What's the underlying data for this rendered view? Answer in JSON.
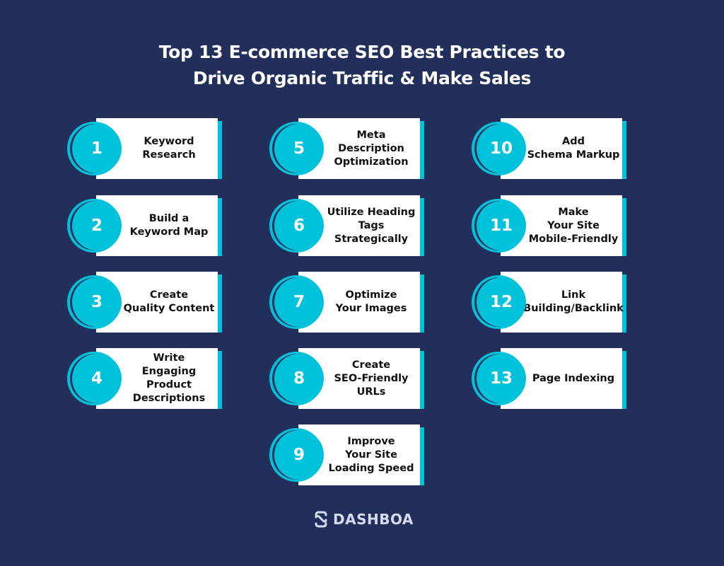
{
  "title": {
    "line1": "Top 13 E-commerce SEO Best Practices to",
    "line2": "Drive Organic Traffic & Make Sales"
  },
  "items": [
    {
      "number": "1",
      "label": "Keyword\nResearch"
    },
    {
      "number": "2",
      "label": "Build a\nKeyword Map"
    },
    {
      "number": "3",
      "label": "Create\nQuality Content"
    },
    {
      "number": "4",
      "label": "Write\nEngaging Product\nDescriptions"
    },
    {
      "number": "5",
      "label": "Meta Description\nOptimization"
    },
    {
      "number": "6",
      "label": "Utilize Heading\nTags Strategically"
    },
    {
      "number": "7",
      "label": "Optimize\nYour Images"
    },
    {
      "number": "8",
      "label": "Create\nSEO-Friendly URLs"
    },
    {
      "number": "9",
      "label": "Improve\nYour Site\nLoading Speed"
    },
    {
      "number": "10",
      "label": "Add\nSchema Markup"
    },
    {
      "number": "11",
      "label": "Make\nYour Site\nMobile-Friendly"
    },
    {
      "number": "12",
      "label": "Link\nBuilding/Backlink"
    },
    {
      "number": "13",
      "label": "Page Indexing"
    }
  ],
  "brand": {
    "name": "DASHBOA",
    "icon": "dashboa-logo-icon"
  },
  "colors": {
    "background": "#222f5b",
    "accent": "#00c2da",
    "card": "#ffffff"
  }
}
